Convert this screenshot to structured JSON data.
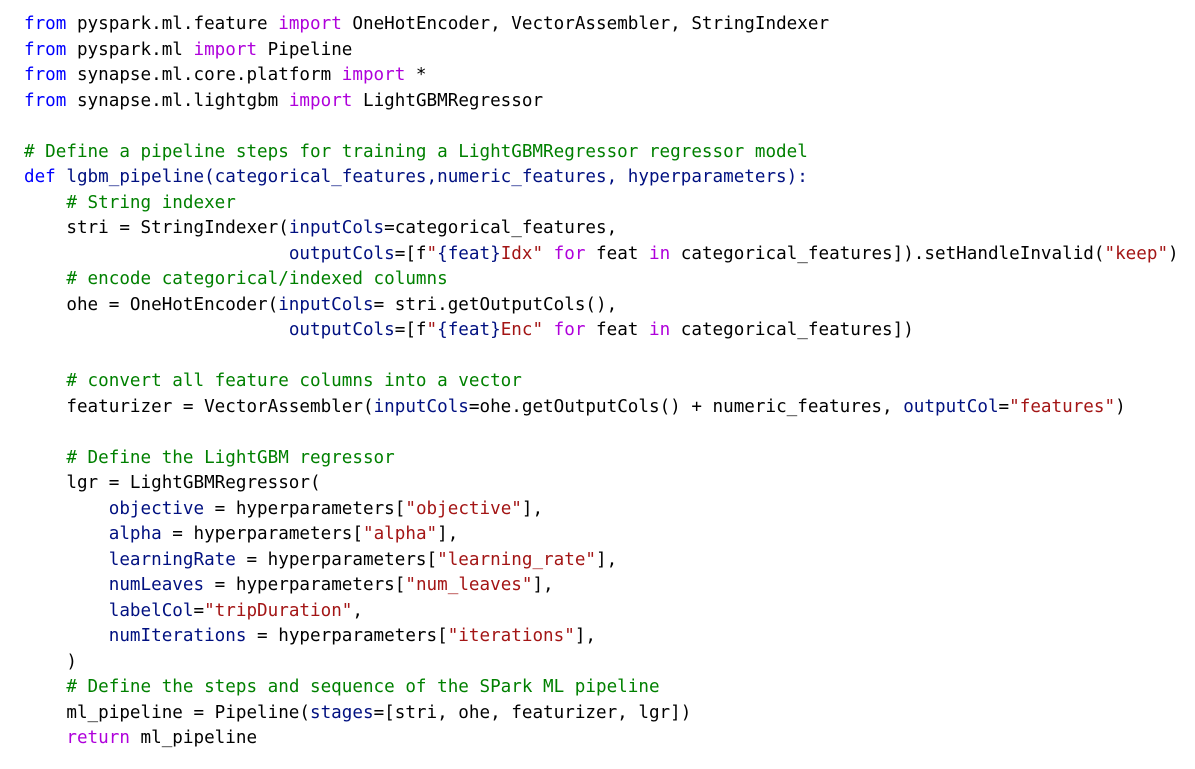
{
  "editor": {
    "lines": [
      [
        {
          "t": "from",
          "c": "kw"
        },
        {
          "t": " pyspark.ml.feature ",
          "c": "tx"
        },
        {
          "t": "import",
          "c": "kw2"
        },
        {
          "t": " OneHotEncoder, VectorAssembler, StringIndexer",
          "c": "tx"
        }
      ],
      [
        {
          "t": "from",
          "c": "kw"
        },
        {
          "t": " pyspark.ml ",
          "c": "tx"
        },
        {
          "t": "import",
          "c": "kw2"
        },
        {
          "t": " Pipeline",
          "c": "tx"
        }
      ],
      [
        {
          "t": "from",
          "c": "kw"
        },
        {
          "t": " synapse.ml.core.platform ",
          "c": "tx"
        },
        {
          "t": "import",
          "c": "kw2"
        },
        {
          "t": " *",
          "c": "tx"
        }
      ],
      [
        {
          "t": "from",
          "c": "kw"
        },
        {
          "t": " synapse.ml.lightgbm ",
          "c": "tx"
        },
        {
          "t": "import",
          "c": "kw2"
        },
        {
          "t": " LightGBMRegressor",
          "c": "tx"
        }
      ],
      [],
      [
        {
          "t": "# Define a pipeline steps for training a LightGBMRegressor regressor model",
          "c": "cm"
        }
      ],
      [
        {
          "t": "def",
          "c": "kw"
        },
        {
          "t": " lgbm_pipeline(categorical_features,numeric_features, hyperparameters):",
          "c": "pr"
        }
      ],
      [
        {
          "t": "    ",
          "c": "tx"
        },
        {
          "t": "# String indexer",
          "c": "cm"
        }
      ],
      [
        {
          "t": "    stri = StringIndexer(",
          "c": "tx"
        },
        {
          "t": "inputCols",
          "c": "pr"
        },
        {
          "t": "=categorical_features,",
          "c": "tx"
        }
      ],
      [
        {
          "t": "                         ",
          "c": "tx"
        },
        {
          "t": "outputCols",
          "c": "pr"
        },
        {
          "t": "=[f",
          "c": "tx"
        },
        {
          "t": "\"",
          "c": "st"
        },
        {
          "t": "{feat}",
          "c": "pr"
        },
        {
          "t": "Idx\"",
          "c": "st"
        },
        {
          "t": " ",
          "c": "tx"
        },
        {
          "t": "for",
          "c": "kw2"
        },
        {
          "t": " feat ",
          "c": "tx"
        },
        {
          "t": "in",
          "c": "kw2"
        },
        {
          "t": " categorical_features]).setHandleInvalid(",
          "c": "tx"
        },
        {
          "t": "\"keep\"",
          "c": "st"
        },
        {
          "t": ")",
          "c": "tx"
        }
      ],
      [
        {
          "t": "    ",
          "c": "tx"
        },
        {
          "t": "# encode categorical/indexed columns",
          "c": "cm"
        }
      ],
      [
        {
          "t": "    ohe = OneHotEncoder(",
          "c": "tx"
        },
        {
          "t": "inputCols",
          "c": "pr"
        },
        {
          "t": "= stri.getOutputCols(),",
          "c": "tx"
        }
      ],
      [
        {
          "t": "                         ",
          "c": "tx"
        },
        {
          "t": "outputCols",
          "c": "pr"
        },
        {
          "t": "=[f",
          "c": "tx"
        },
        {
          "t": "\"",
          "c": "st"
        },
        {
          "t": "{feat}",
          "c": "pr"
        },
        {
          "t": "Enc\"",
          "c": "st"
        },
        {
          "t": " ",
          "c": "tx"
        },
        {
          "t": "for",
          "c": "kw2"
        },
        {
          "t": " feat ",
          "c": "tx"
        },
        {
          "t": "in",
          "c": "kw2"
        },
        {
          "t": " categorical_features])",
          "c": "tx"
        }
      ],
      [],
      [
        {
          "t": "    ",
          "c": "tx"
        },
        {
          "t": "# convert all feature columns into a vector",
          "c": "cm"
        }
      ],
      [
        {
          "t": "    featurizer = VectorAssembler(",
          "c": "tx"
        },
        {
          "t": "inputCols",
          "c": "pr"
        },
        {
          "t": "=ohe.getOutputCols() + numeric_features, ",
          "c": "tx"
        },
        {
          "t": "outputCol",
          "c": "pr"
        },
        {
          "t": "=",
          "c": "tx"
        },
        {
          "t": "\"features\"",
          "c": "st"
        },
        {
          "t": ")",
          "c": "tx"
        }
      ],
      [],
      [
        {
          "t": "    ",
          "c": "tx"
        },
        {
          "t": "# Define the LightGBM regressor",
          "c": "cm"
        }
      ],
      [
        {
          "t": "    lgr = LightGBMRegressor(",
          "c": "tx"
        }
      ],
      [
        {
          "t": "        ",
          "c": "tx"
        },
        {
          "t": "objective",
          "c": "pr"
        },
        {
          "t": " = hyperparameters[",
          "c": "tx"
        },
        {
          "t": "\"objective\"",
          "c": "st"
        },
        {
          "t": "],",
          "c": "tx"
        }
      ],
      [
        {
          "t": "        ",
          "c": "tx"
        },
        {
          "t": "alpha",
          "c": "pr"
        },
        {
          "t": " = hyperparameters[",
          "c": "tx"
        },
        {
          "t": "\"alpha\"",
          "c": "st"
        },
        {
          "t": "],",
          "c": "tx"
        }
      ],
      [
        {
          "t": "        ",
          "c": "tx"
        },
        {
          "t": "learningRate",
          "c": "pr"
        },
        {
          "t": " = hyperparameters[",
          "c": "tx"
        },
        {
          "t": "\"learning_rate\"",
          "c": "st"
        },
        {
          "t": "],",
          "c": "tx"
        }
      ],
      [
        {
          "t": "        ",
          "c": "tx"
        },
        {
          "t": "numLeaves",
          "c": "pr"
        },
        {
          "t": " = hyperparameters[",
          "c": "tx"
        },
        {
          "t": "\"num_leaves\"",
          "c": "st"
        },
        {
          "t": "],",
          "c": "tx"
        }
      ],
      [
        {
          "t": "        ",
          "c": "tx"
        },
        {
          "t": "labelCol",
          "c": "pr"
        },
        {
          "t": "=",
          "c": "tx"
        },
        {
          "t": "\"tripDuration\"",
          "c": "st"
        },
        {
          "t": ",",
          "c": "tx"
        }
      ],
      [
        {
          "t": "        ",
          "c": "tx"
        },
        {
          "t": "numIterations",
          "c": "pr"
        },
        {
          "t": " = hyperparameters[",
          "c": "tx"
        },
        {
          "t": "\"iterations\"",
          "c": "st"
        },
        {
          "t": "],",
          "c": "tx"
        }
      ],
      [
        {
          "t": "    )",
          "c": "tx"
        }
      ],
      [
        {
          "t": "    ",
          "c": "tx"
        },
        {
          "t": "# Define the steps and sequence of the SPark ML pipeline",
          "c": "cm"
        }
      ],
      [
        {
          "t": "    ml_pipeline = Pipeline(",
          "c": "tx"
        },
        {
          "t": "stages",
          "c": "pr"
        },
        {
          "t": "=[stri, ohe, featurizer, lgr])",
          "c": "tx"
        }
      ],
      [
        {
          "t": "    ",
          "c": "tx"
        },
        {
          "t": "return",
          "c": "kw2"
        },
        {
          "t": " ml_pipeline",
          "c": "tx"
        }
      ]
    ]
  },
  "colors": {
    "keyword": "#0000ff",
    "control_keyword": "#af00db",
    "comment": "#008000",
    "string": "#a31515",
    "parameter": "#001080",
    "text": "#000000",
    "background": "#ffffff"
  }
}
